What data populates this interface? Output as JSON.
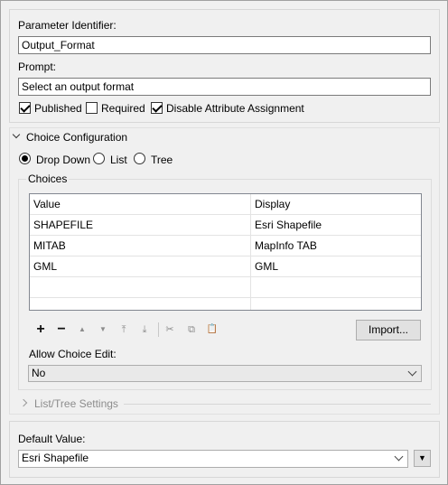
{
  "parameter": {
    "identifier_label": "Parameter Identifier:",
    "identifier_value": "Output_Format",
    "prompt_label": "Prompt:",
    "prompt_value": "Select an output format",
    "checkboxes": [
      {
        "label": "Published",
        "checked": true
      },
      {
        "label": "Required",
        "checked": false
      },
      {
        "label": "Disable Attribute Assignment",
        "checked": true
      }
    ]
  },
  "choice_config": {
    "section_label": "Choice Configuration",
    "radios": [
      {
        "label": "Drop Down",
        "checked": true
      },
      {
        "label": "List",
        "checked": false
      },
      {
        "label": "Tree",
        "checked": false
      }
    ],
    "choices_group_label": "Choices",
    "table": {
      "columns": [
        "Value",
        "Display"
      ],
      "rows": [
        [
          "SHAPEFILE",
          "Esri Shapefile"
        ],
        [
          "MITAB",
          "MapInfo TAB"
        ],
        [
          "GML",
          "GML"
        ],
        [
          "",
          ""
        ]
      ]
    },
    "toolbar": {
      "add": "+",
      "remove": "−",
      "move_up": "▲",
      "move_down": "▼",
      "move_top": "⤒",
      "move_bottom": "⤓",
      "cut": "✂",
      "copy": "⧉",
      "paste": "📋",
      "import_label": "Import..."
    },
    "allow_edit_label": "Allow Choice Edit:",
    "allow_edit_value": "No",
    "list_tree_label": "List/Tree Settings"
  },
  "default_value": {
    "label": "Default Value:",
    "value": "Esri Shapefile"
  }
}
